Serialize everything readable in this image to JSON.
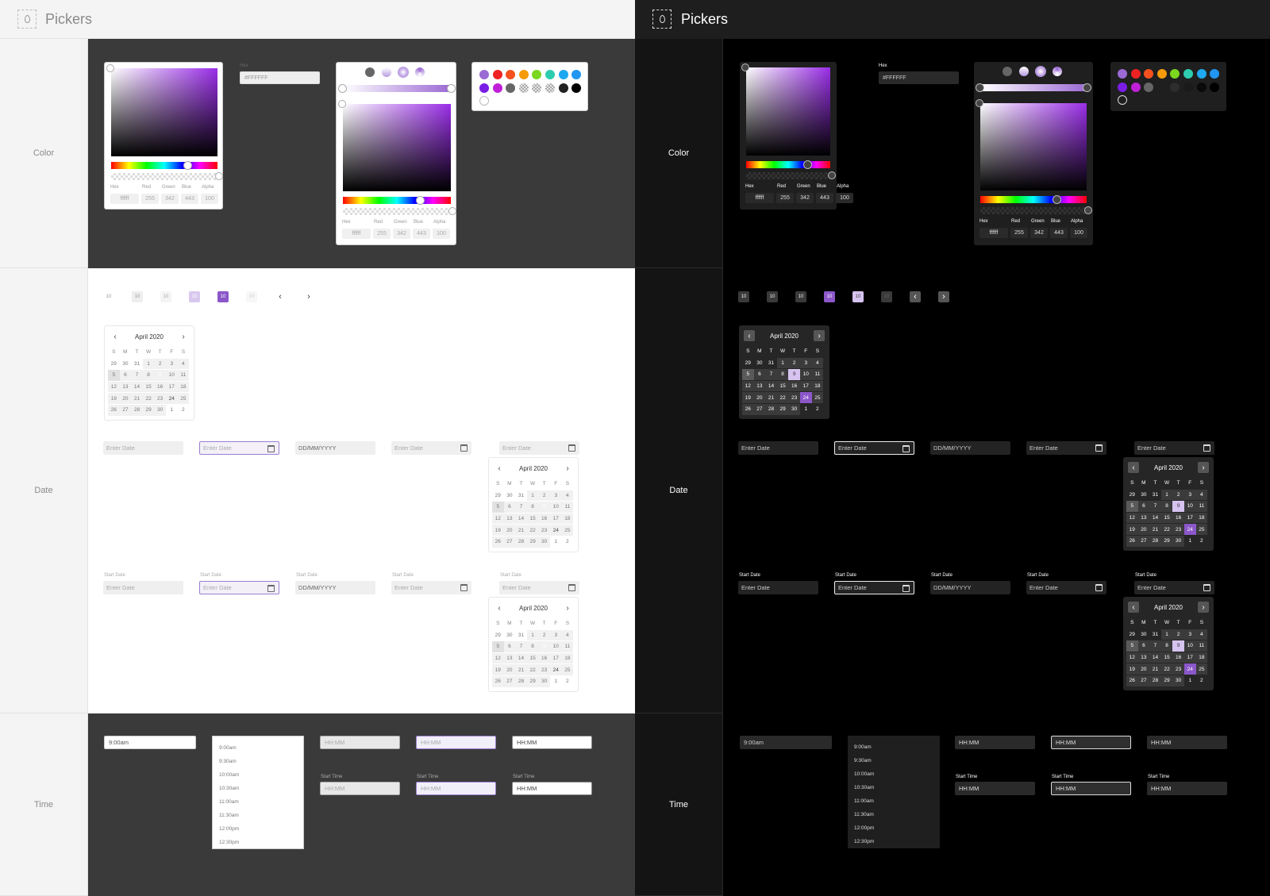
{
  "app_title": "Pickers",
  "sections": {
    "color": "Color",
    "date": "Date",
    "time": "Time"
  },
  "color": {
    "hex_label": "Hex",
    "hex_value": "#FFFFFF",
    "field_labels": [
      "Hex",
      "Red",
      "Green",
      "Blue",
      "Alpha"
    ],
    "field_values": [
      "ffffff",
      "255",
      "342",
      "443",
      "100"
    ],
    "swatches": [
      "#9b6ad4",
      "#ee2222",
      "#f4511e",
      "#f59b0b",
      "#7bd71f",
      "#2dccb0",
      "#1ea8f0",
      "#2196f3",
      "#7a1ee6",
      "#c01fd8",
      "#666666",
      "#d8d8d8",
      "#b0b0b0",
      "#8a8a8a",
      "#222222",
      "#000000"
    ],
    "accent": "#8b57c9"
  },
  "pagination": {
    "page_label": "10"
  },
  "calendar": {
    "month": "April 2020",
    "weekdays": [
      "S",
      "M",
      "T",
      "W",
      "T",
      "F",
      "S"
    ],
    "days": [
      "29",
      "30",
      "31",
      "1",
      "2",
      "3",
      "4",
      "5",
      "6",
      "7",
      "8",
      "9",
      "10",
      "11",
      "12",
      "13",
      "14",
      "15",
      "16",
      "17",
      "18",
      "19",
      "20",
      "21",
      "22",
      "23",
      "24",
      "25",
      "26",
      "27",
      "28",
      "29",
      "30",
      "1",
      "2"
    ],
    "selected_day": "9",
    "highlighted_day": "24",
    "today_day": "6"
  },
  "date": {
    "placeholder": "Enter Date",
    "format_placeholder": "DD/MM/YYYY",
    "field_label": "Start Date"
  },
  "time": {
    "value": "9:00am",
    "placeholder": "HH:MM",
    "field_label": "Start Time",
    "options": [
      "9:00am",
      "9:30am",
      "10:00am",
      "10:30am",
      "11:00am",
      "11:30am",
      "12:00pm",
      "12:30pm"
    ]
  }
}
